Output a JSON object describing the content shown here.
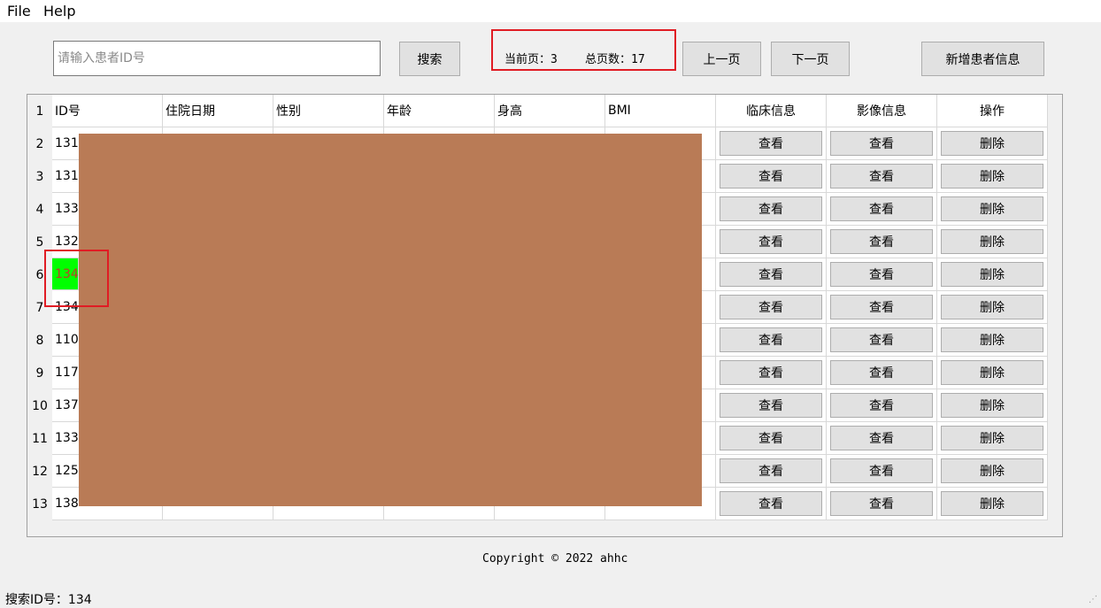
{
  "menu": {
    "file": "File",
    "help": "Help"
  },
  "search": {
    "placeholder": "请输入患者ID号",
    "value": "",
    "button": "搜索"
  },
  "pagination": {
    "current_label": "当前页：3",
    "total_label": "总页数：17",
    "prev": "上一页",
    "next": "下一页"
  },
  "add_button": "新增患者信息",
  "table": {
    "header_row_number": "1",
    "columns": [
      "ID号",
      "住院日期",
      "性别",
      "年龄",
      "身高",
      "BMI",
      "临床信息",
      "影像信息",
      "操作"
    ],
    "rows": [
      {
        "num": "2",
        "id": "131"
      },
      {
        "num": "3",
        "id": "131"
      },
      {
        "num": "4",
        "id": "133"
      },
      {
        "num": "5",
        "id": "132"
      },
      {
        "num": "6",
        "id": "134",
        "highlight": true
      },
      {
        "num": "7",
        "id": "134"
      },
      {
        "num": "8",
        "id": "110"
      },
      {
        "num": "9",
        "id": "117"
      },
      {
        "num": "10",
        "id": "137"
      },
      {
        "num": "11",
        "id": "133"
      },
      {
        "num": "12",
        "id": "125"
      },
      {
        "num": "13",
        "id": "138"
      }
    ],
    "view_label": "查看",
    "delete_label": "删除"
  },
  "footer": {
    "copyright": "Copyright © 2022 ahhc"
  },
  "status_bar": {
    "text": "搜索ID号：134"
  },
  "colors": {
    "highlight_bg": "#00ff00",
    "highlight_text": "#c0392b",
    "annotation_red": "#e01c24",
    "redaction": "#b97b56"
  }
}
